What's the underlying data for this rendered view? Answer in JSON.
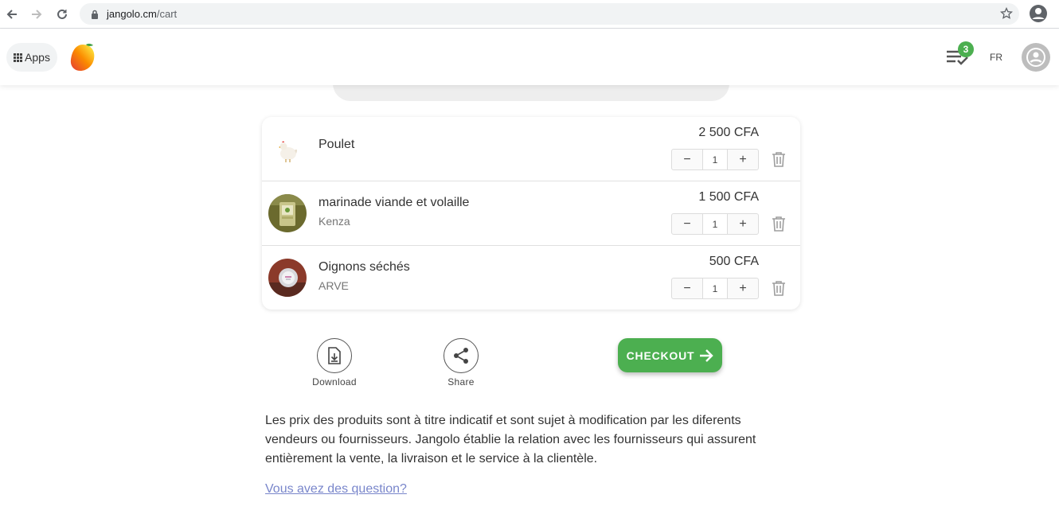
{
  "browser": {
    "url_host": "jangolo.cm",
    "url_path": "/cart"
  },
  "header": {
    "apps_label": "Apps",
    "orders_badge": "3",
    "language": "FR"
  },
  "cart": {
    "items": [
      {
        "name": "Poulet",
        "vendor": "",
        "price": "2 500 CFA",
        "quantity": "1"
      },
      {
        "name": "marinade viande et volaille",
        "vendor": "Kenza",
        "price": "1 500 CFA",
        "quantity": "1"
      },
      {
        "name": "Oignons séchés",
        "vendor": "ARVE",
        "price": "500 CFA",
        "quantity": "1"
      }
    ],
    "decrement_symbol": "−",
    "increment_symbol": "+"
  },
  "actions": {
    "download_label": "Download",
    "share_label": "Share",
    "checkout_label": "CHECKOUT"
  },
  "footer": {
    "disclaimer": "Les prix des produits sont à titre indicatif et sont sujet à modification par les diferents vendeurs ou fournisseurs. Jangolo établie la relation avec les fournisseurs qui assurent entièrement la vente, la livraison et le service à la clientèle.",
    "question_link": "Vous avez des question?"
  },
  "colors": {
    "accent_green": "#4caf50",
    "link_blue": "#7986cb"
  }
}
